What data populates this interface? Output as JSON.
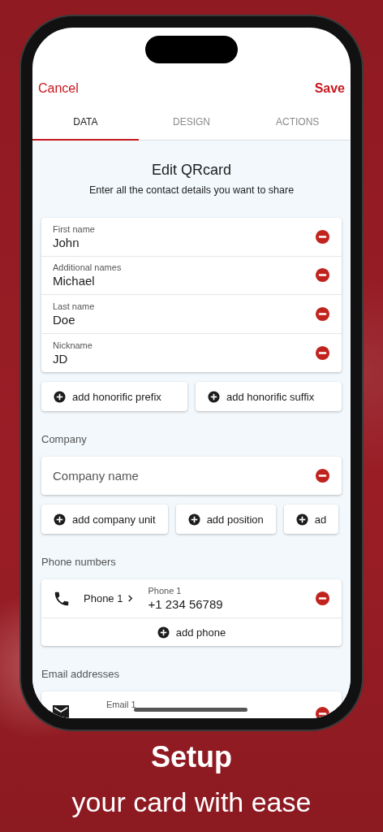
{
  "header": {
    "cancel": "Cancel",
    "save": "Save"
  },
  "tabs": [
    {
      "label": "DATA",
      "selected": true
    },
    {
      "label": "DESIGN",
      "selected": false
    },
    {
      "label": "ACTIONS",
      "selected": false
    }
  ],
  "title": "Edit QRcard",
  "subtitle": "Enter all the contact details you want to share",
  "name_fields": [
    {
      "label": "First name",
      "value": "John"
    },
    {
      "label": "Additional names",
      "value": "Michael"
    },
    {
      "label": "Last name",
      "value": "Doe"
    },
    {
      "label": "Nickname",
      "value": "JD"
    }
  ],
  "name_actions": [
    "add honorific prefix",
    "add honorific suffix"
  ],
  "company": {
    "heading": "Company",
    "placeholder": "Company name",
    "actions": [
      "add company unit",
      "add position",
      "ad"
    ]
  },
  "phones": {
    "heading": "Phone numbers",
    "items": [
      {
        "type": "Phone 1",
        "label": "Phone 1",
        "value": "+1 234 56789"
      }
    ],
    "add": "add phone"
  },
  "emails": {
    "heading": "Email addresses",
    "items": [
      {
        "label": "Email 1"
      }
    ]
  },
  "caption": {
    "title": "Setup",
    "subtitle": "your card with ease"
  }
}
